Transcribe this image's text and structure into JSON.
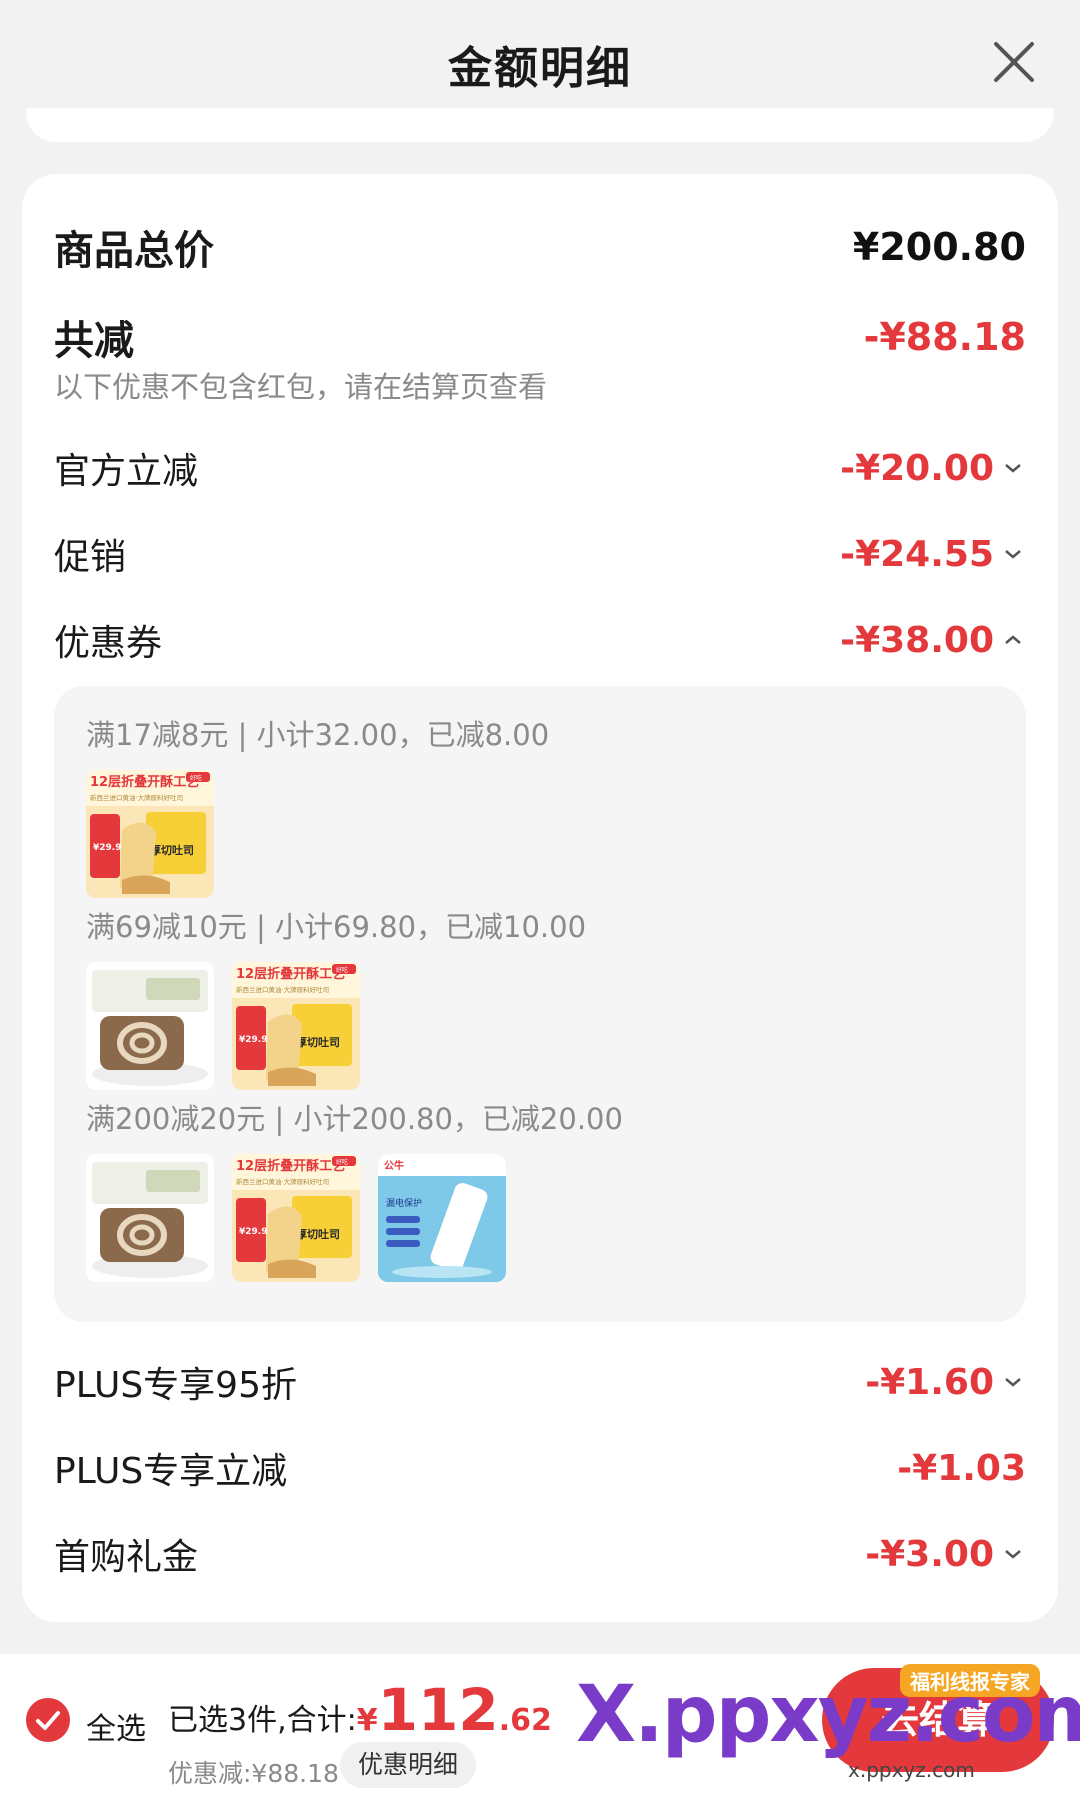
{
  "header": {
    "title": "金额明细"
  },
  "summary_card": {
    "total_label": "商品总价",
    "total_value": "¥200.80",
    "reduce_label": "共减",
    "reduce_value": "-¥88.18",
    "reduce_note": "以下优惠不包含红包，请在结算页查看",
    "items": [
      {
        "label": "官方立减",
        "value": "-¥20.00"
      },
      {
        "label": "促销",
        "value": "-¥24.55"
      },
      {
        "label": "优惠券",
        "value": "-¥38.00"
      },
      {
        "label": "PLUS专享95折",
        "value": "-¥1.60"
      },
      {
        "label": "PLUS专享立减",
        "value": "-¥1.03"
      },
      {
        "label": "首购礼金",
        "value": "-¥3.00"
      }
    ]
  },
  "coupons": [
    {
      "text": "满17减8元 | 小计32.00，已减8.00"
    },
    {
      "text": "满69减10元 | 小计69.80，已减10.00"
    },
    {
      "text": "满200减20元 | 小计200.80，已减20.00"
    }
  ],
  "thumbs": {
    "banner_title": "12层折叠开酥工艺",
    "banner_sub": "新西兰进口黄油·大牌原料好吐司",
    "brand_tag": "好吃",
    "product_label": "厚切吐司",
    "price_tag": "¥29.9",
    "power_title": "公牛",
    "power_label": "漏电保护"
  },
  "bottom": {
    "select_all": "全选",
    "selected_text": "已选3件,合计:",
    "currency": "¥",
    "total_int": "112",
    "total_dec": ".62",
    "discount_text": "优惠减:¥88.18",
    "detail_button": "优惠明细",
    "checkout_button": "去结算"
  },
  "watermark": {
    "big": "X.ppxyz.com",
    "badge": "福利线报专家",
    "small": "x.ppxyz.com"
  },
  "colors": {
    "accent": "#e4393c",
    "background": "#f2f2f2",
    "muted": "#8a8a8a"
  }
}
